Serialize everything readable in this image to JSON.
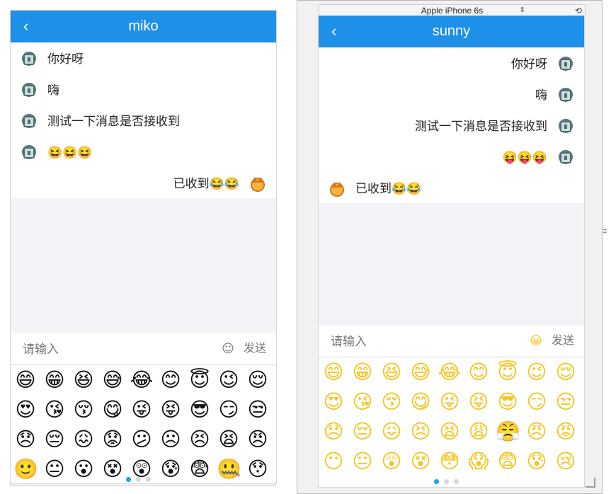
{
  "left": {
    "title": "miko",
    "back_icon": "chevron-left-icon",
    "messages": [
      {
        "text": "你好呀",
        "side": "left",
        "avatar": "bot"
      },
      {
        "text": "嗨",
        "side": "left",
        "avatar": "bot"
      },
      {
        "text": "测试一下消息是否接收到",
        "side": "left",
        "avatar": "bot"
      },
      {
        "text": "😆😆😆",
        "side": "left",
        "avatar": "bot"
      },
      {
        "text": "已收到😂😂",
        "side": "right",
        "avatar": "cat"
      }
    ],
    "input_placeholder": "请输入",
    "emoji_toggle": "☺",
    "send_label": "发送",
    "emojis": [
      "😄",
      "😁",
      "😆",
      "😅",
      "😂",
      "😊",
      "😇",
      "😉",
      "😌",
      "😍",
      "😘",
      "😚",
      "😋",
      "😜",
      "😝",
      "😎",
      "😏",
      "😒",
      "😞",
      "😔",
      "😖",
      "😟",
      "😕",
      "☹",
      "😣",
      "😫",
      "😠",
      "🙂",
      "😐",
      "😮",
      "😵",
      "😲",
      "😰",
      "😨",
      "🤐",
      "😯"
    ],
    "page_dots": 3,
    "active_dot": 0
  },
  "right": {
    "device_name": "Apple iPhone 6s",
    "title": "sunny",
    "back_icon": "chevron-left-icon",
    "messages": [
      {
        "text": "你好呀",
        "side": "right",
        "avatar": "bot"
      },
      {
        "text": "嗨",
        "side": "right",
        "avatar": "bot"
      },
      {
        "text": "测试一下消息是否接收到",
        "side": "right",
        "avatar": "bot"
      },
      {
        "text": "😝😝😝",
        "side": "right",
        "avatar": "bot"
      },
      {
        "text": "已收到😂😂",
        "side": "left",
        "avatar": "cat"
      }
    ],
    "input_placeholder": "请输入",
    "emoji_toggle": "😀",
    "send_label": "发送",
    "emojis": [
      "😄",
      "😁",
      "😆",
      "😅",
      "😂",
      "😊",
      "😇",
      "😉",
      "😌",
      "😍",
      "😘",
      "😚",
      "😋",
      "😜",
      "😝",
      "😎",
      "😏",
      "😒",
      "😞",
      "😔",
      "😖",
      "😣",
      "😫",
      "😩",
      "😤",
      "😠",
      "😡",
      "😶",
      "😐",
      "😲",
      "😵",
      "😳",
      "😱",
      "😨",
      "😰",
      "😢"
    ],
    "page_dots": 3,
    "active_dot": 0
  },
  "colors": {
    "header": "#1e90e8",
    "active_dot": "#1aa2e8",
    "gray_area": "#f3f3f7"
  }
}
